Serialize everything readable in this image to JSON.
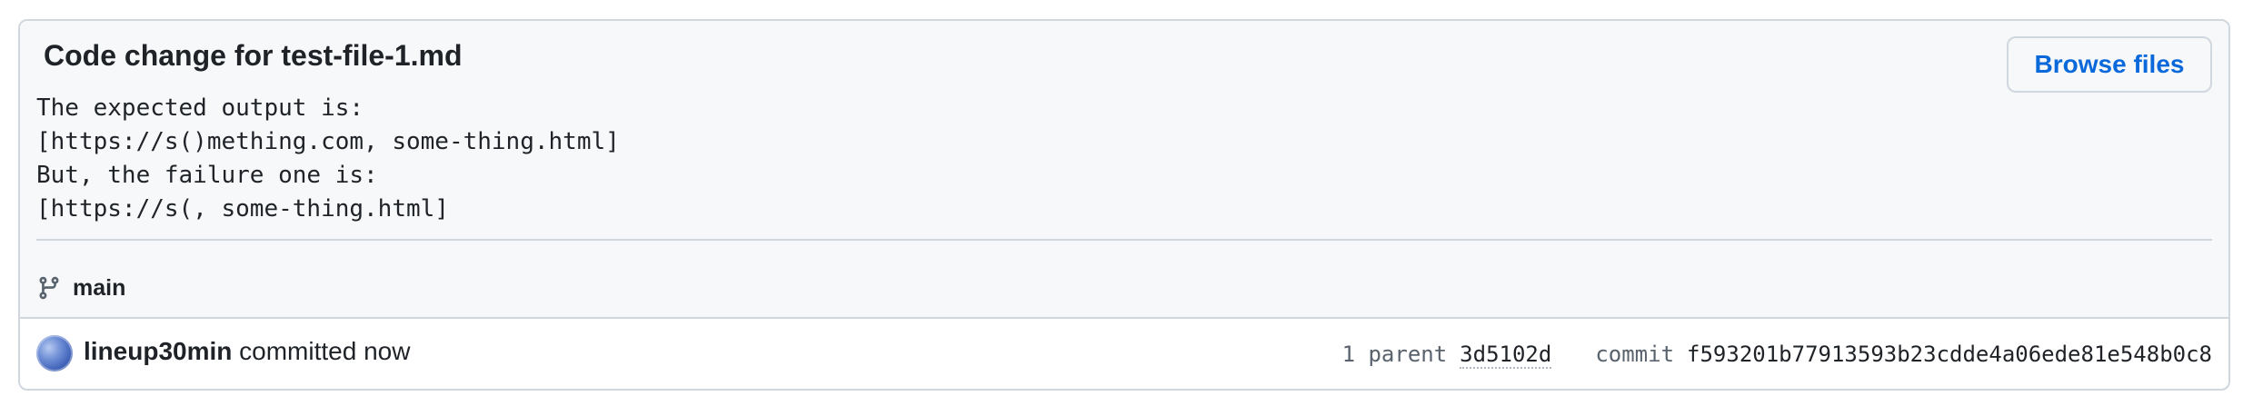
{
  "commit": {
    "title": "Code change for test-file-1.md",
    "description_lines": [
      "The expected output is:",
      "[https://s()mething.com, some-thing.html]",
      "But, the failure one is:",
      "[https://s(, some-thing.html]"
    ],
    "branch": "main",
    "author": "lineup30min",
    "committed_text": "committed now",
    "parent_count_label": "1 parent",
    "parent_hash": "3d5102d",
    "commit_label": "commit",
    "commit_hash": "f593201b77913593b23cdde4a06ede81e548b0c8"
  },
  "actions": {
    "browse_files_label": "Browse files"
  },
  "colors": {
    "link_blue": "#0969da",
    "border": "#d0d7de",
    "header_bg": "#f6f8fa",
    "muted_text": "#59636e"
  },
  "icons": {
    "branch": "git-branch-icon",
    "avatar": "user-avatar"
  }
}
